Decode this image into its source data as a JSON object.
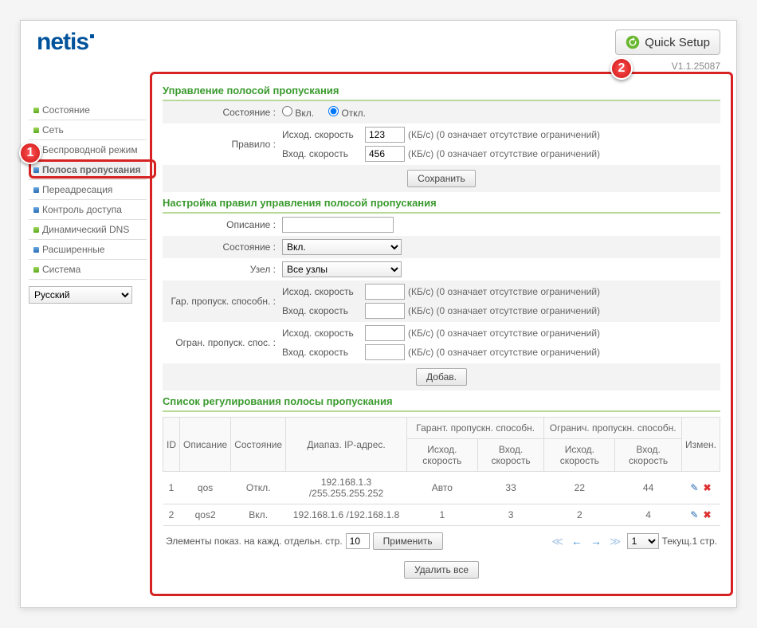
{
  "logo": "netis",
  "quick_setup": "Quick Setup",
  "version": "V1.1.25087",
  "sidebar": {
    "items": [
      {
        "label": "Состояние",
        "style": "green"
      },
      {
        "label": "Сеть",
        "style": "green"
      },
      {
        "label": "Беспроводной режим",
        "style": "blue"
      },
      {
        "label": "Полоса пропускания",
        "style": "blue",
        "active": true
      },
      {
        "label": "Переадресация",
        "style": "blue"
      },
      {
        "label": "Контроль доступа",
        "style": "blue"
      },
      {
        "label": "Динамический DNS",
        "style": "green"
      },
      {
        "label": "Расширенные",
        "style": "blue"
      },
      {
        "label": "Система",
        "style": "green"
      }
    ],
    "language": "Русский"
  },
  "sec1": {
    "title": "Управление полосой пропускания",
    "status_label": "Состояние :",
    "opt_on": "Вкл.",
    "opt_off": "Откл.",
    "rule_label": "Правило :",
    "out_label": "Исход. скорость",
    "in_label": "Вход. скорость",
    "out_val": "123",
    "in_val": "456",
    "hint": "(КБ/с) (0 означает отсутствие ограничений)",
    "save": "Сохранить"
  },
  "sec2": {
    "title": "Настройка правил управления полосой пропускания",
    "desc_label": "Описание :",
    "desc_val": "",
    "status_label": "Состояние :",
    "status_val": "Вкл.",
    "node_label": "Узел :",
    "node_val": "Все узлы",
    "guar_label": "Гар. пропуск. способн. :",
    "limit_label": "Огран. пропуск. спос. :",
    "out_label": "Исход. скорость",
    "in_label": "Вход. скорость",
    "hint": "(КБ/с) (0 означает отсутствие ограничений)",
    "add": "Добав."
  },
  "sec3": {
    "title": "Список регулирования полосы пропускания",
    "th_id": "ID",
    "th_desc": "Описание",
    "th_state": "Состояние",
    "th_range": "Диапаз. IP-адрес.",
    "th_guar": "Гарант. пропускн. способн.",
    "th_limit": "Огранич. пропускн. способн.",
    "th_edit": "Измен.",
    "th_out": "Исход. скорость",
    "th_in": "Вход. скорость",
    "rows": [
      {
        "id": "1",
        "desc": "qos",
        "state": "Откл.",
        "range": "192.168.1.3 /255.255.255.252",
        "g_out": "Авто",
        "g_in": "33",
        "l_out": "22",
        "l_in": "44"
      },
      {
        "id": "2",
        "desc": "qos2",
        "state": "Вкл.",
        "range": "192.168.1.6 /192.168.1.8",
        "g_out": "1",
        "g_in": "3",
        "l_out": "2",
        "l_in": "4"
      }
    ],
    "per_page_label": "Элементы показ. на кажд. отдельн. стр.",
    "per_page_val": "10",
    "apply": "Применить",
    "cur_page_sel": "1",
    "cur_page_txt": "Текущ.1 стр.",
    "delete_all": "Удалить все"
  },
  "markers": {
    "m1": "1",
    "m2": "2"
  }
}
